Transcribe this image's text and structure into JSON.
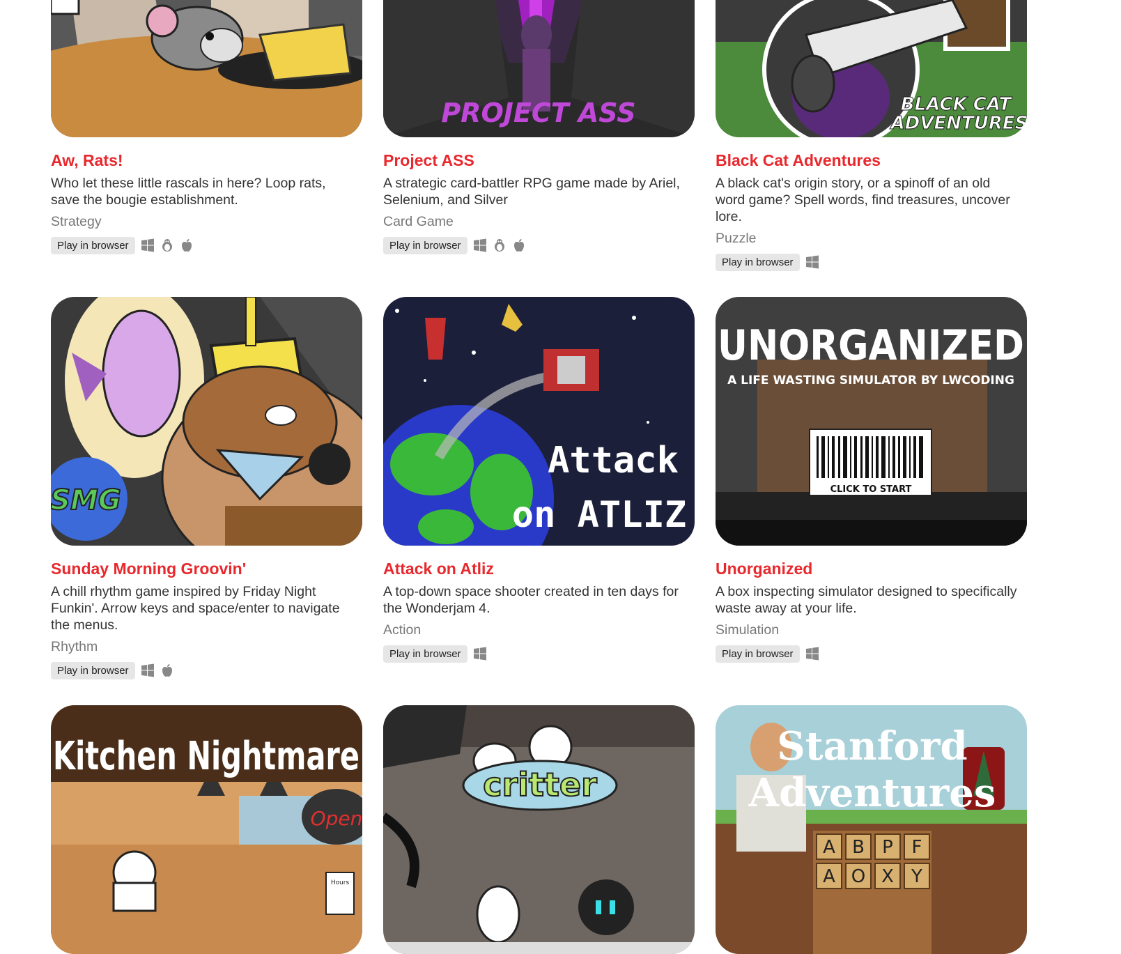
{
  "games": [
    {
      "title": "Aw, Rats!",
      "description": "Who let these little rascals in here? Loop rats, save the bougie establishment.",
      "genre": "Strategy",
      "badge": "Play in browser",
      "platforms": [
        "windows-icon",
        "linux-icon",
        "apple-icon"
      ],
      "art": "rats"
    },
    {
      "title": "Project ASS",
      "description": "A strategic card-battler RPG game made by Ariel, Selenium, and Silver",
      "genre": "Card Game",
      "badge": "Play in browser",
      "platforms": [
        "windows-icon",
        "linux-icon",
        "apple-icon"
      ],
      "art": "project",
      "art_text": "PROJECT ASS"
    },
    {
      "title": "Black Cat Adventures",
      "description": "A black cat's origin story, or a spinoff of an old word game? Spell words, find treasures, uncover lore.",
      "genre": "Puzzle",
      "badge": "Play in browser",
      "platforms": [
        "windows-icon"
      ],
      "art": "blackcat",
      "art_text": [
        "BLACK CAT",
        "ADVENTURES"
      ]
    },
    {
      "title": "Sunday Morning Groovin'",
      "description": "A chill rhythm game inspired by Friday Night Funkin'. Arrow keys and space/enter to navigate the menus.",
      "genre": "Rhythm",
      "badge": "Play in browser",
      "platforms": [
        "windows-icon",
        "apple-icon"
      ],
      "art": "smg",
      "art_text": "SMG"
    },
    {
      "title": "Attack on Atliz",
      "description": "A top-down space shooter created in ten days for the Wonderjam 4.",
      "genre": "Action",
      "badge": "Play in browser",
      "platforms": [
        "windows-icon"
      ],
      "art": "atliz",
      "art_text": [
        "Attack",
        "on ATLIZ"
      ]
    },
    {
      "title": "Unorganized",
      "description": "A box inspecting simulator designed to specifically waste away at your life.",
      "genre": "Simulation",
      "badge": "Play in browser",
      "platforms": [
        "windows-icon"
      ],
      "art": "unorg",
      "art_text": [
        "UNORGANIZED",
        "A LIFE WASTING SIMULATOR BY LWCODING",
        "CLICK TO START"
      ]
    },
    {
      "title": "",
      "description": "",
      "genre": "",
      "badge": "",
      "platforms": [],
      "art": "kitchen",
      "art_text": [
        "Kitchen Nightmare",
        "Open",
        "Hours"
      ]
    },
    {
      "title": "",
      "description": "",
      "genre": "",
      "badge": "",
      "platforms": [],
      "art": "critter",
      "art_text": "critter"
    },
    {
      "title": "",
      "description": "",
      "genre": "",
      "badge": "",
      "platforms": [],
      "art": "stanford",
      "art_text": [
        "Stanford",
        "Adventures",
        "A",
        "B",
        "P",
        "F",
        "A",
        "O",
        "X",
        "Y"
      ]
    }
  ]
}
